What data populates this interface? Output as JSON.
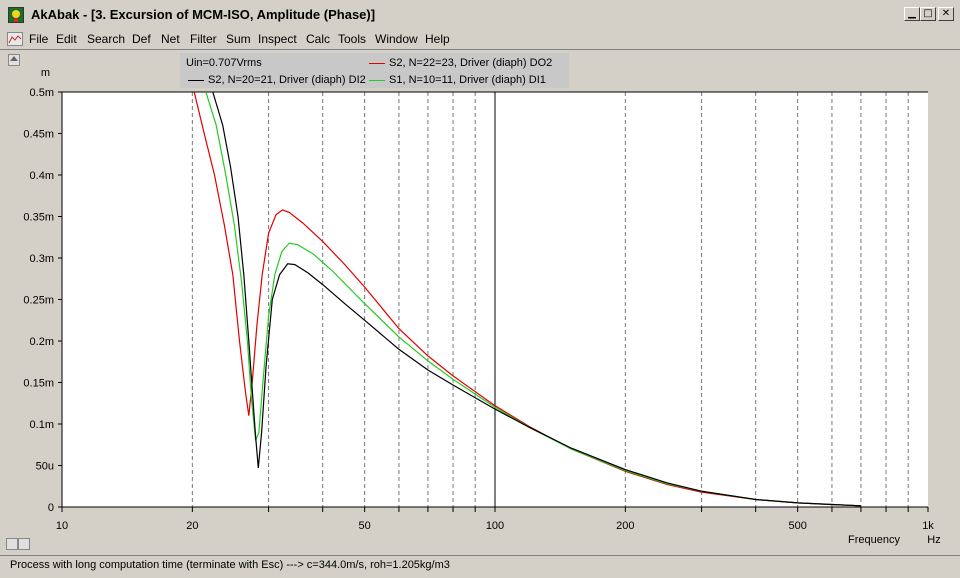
{
  "window": {
    "app_name": "AkAbak",
    "title": "AkAbak - [3. Excursion of MCM-ISO, Amplitude (Phase)]",
    "minimize": "▁",
    "maximize": "□",
    "close": "✕"
  },
  "menu": {
    "items": [
      "File",
      "Edit",
      "Search",
      "Def",
      "Net",
      "Filter",
      "Sum",
      "Inspect",
      "Calc",
      "Tools",
      "Window",
      "Help"
    ],
    "mdi_minimize": "▁",
    "mdi_restore": "❐",
    "mdi_close": "✕"
  },
  "legend": {
    "condition": "Uin=0.707Vrms",
    "entries": [
      {
        "label": "S2, N=20=21, Driver (diaph) DI2",
        "color": "#000000"
      },
      {
        "label": "S2, N=22=23, Driver (diaph) DO2",
        "color": "#e00000"
      },
      {
        "label": "S1, N=10=11, Driver (diaph) DI1",
        "color": "#22cc22"
      }
    ]
  },
  "chart_data": {
    "type": "line",
    "x_scale": "log",
    "xlim": [
      10,
      1000
    ],
    "ylim": [
      0,
      0.0005
    ],
    "ylabel": "m",
    "xlabel": "Frequency",
    "xunit": "Hz",
    "x_tick_labels": [
      {
        "v": 10,
        "t": "10"
      },
      {
        "v": 20,
        "t": "20"
      },
      {
        "v": 50,
        "t": "50"
      },
      {
        "v": 100,
        "t": "100"
      },
      {
        "v": 200,
        "t": "200"
      },
      {
        "v": 500,
        "t": "500"
      },
      {
        "v": 1000,
        "t": "1k"
      }
    ],
    "y_tick_labels": [
      {
        "v": 0.0005,
        "t": "0.5m"
      },
      {
        "v": 0.00045,
        "t": "0.45m"
      },
      {
        "v": 0.0004,
        "t": "0.4m"
      },
      {
        "v": 0.00035,
        "t": "0.35m"
      },
      {
        "v": 0.0003,
        "t": "0.3m"
      },
      {
        "v": 0.00025,
        "t": "0.25m"
      },
      {
        "v": 0.0002,
        "t": "0.2m"
      },
      {
        "v": 0.00015,
        "t": "0.15m"
      },
      {
        "v": 0.0001,
        "t": "0.1m"
      },
      {
        "v": 5e-05,
        "t": "50u"
      },
      {
        "v": 0,
        "t": "0"
      }
    ],
    "grid": true,
    "series": [
      {
        "name": "S2, N=20=21, Driver (diaph) DI2",
        "color": "#000000",
        "points": [
          [
            22.3,
            0.0005
          ],
          [
            23.5,
            0.00046
          ],
          [
            24.5,
            0.00041
          ],
          [
            25.5,
            0.00035
          ],
          [
            26.3,
            0.00028
          ],
          [
            27,
            0.0002
          ],
          [
            27.6,
            0.00013
          ],
          [
            28,
            8.5e-05
          ],
          [
            28.4,
            4.7e-05
          ],
          [
            28.9,
            9e-05
          ],
          [
            29.6,
            0.00017
          ],
          [
            30.6,
            0.00025
          ],
          [
            31.8,
            0.00028
          ],
          [
            33.2,
            0.000293
          ],
          [
            34.5,
            0.000292
          ],
          [
            37,
            0.000282
          ],
          [
            40,
            0.000268
          ],
          [
            45,
            0.000245
          ],
          [
            50,
            0.000225
          ],
          [
            60,
            0.00019
          ],
          [
            70,
            0.000165
          ],
          [
            80,
            0.000147
          ],
          [
            100,
            0.000118
          ],
          [
            120,
            9.6e-05
          ],
          [
            150,
            7.1e-05
          ],
          [
            200,
            4.5e-05
          ],
          [
            250,
            2.9e-05
          ],
          [
            300,
            1.9e-05
          ],
          [
            400,
            9e-06
          ],
          [
            500,
            5e-06
          ],
          [
            600,
            3e-06
          ],
          [
            700,
            1.5e-06
          ]
        ]
      },
      {
        "name": "S2, N=22=23, Driver (diaph) DO2",
        "color": "#e00000",
        "points": [
          [
            20.2,
            0.0005
          ],
          [
            21.3,
            0.00045
          ],
          [
            22.5,
            0.0004
          ],
          [
            23.7,
            0.00034
          ],
          [
            24.8,
            0.00028
          ],
          [
            25.7,
            0.0002
          ],
          [
            26.5,
            0.00014
          ],
          [
            27,
            0.00011
          ],
          [
            27.5,
            0.00015
          ],
          [
            28.2,
            0.00022
          ],
          [
            29,
            0.00028
          ],
          [
            30,
            0.00033
          ],
          [
            31.2,
            0.000352
          ],
          [
            32.3,
            0.000358
          ],
          [
            33.5,
            0.000355
          ],
          [
            36,
            0.000342
          ],
          [
            40,
            0.00032
          ],
          [
            45,
            0.000292
          ],
          [
            50,
            0.000265
          ],
          [
            60,
            0.000215
          ],
          [
            70,
            0.000182
          ],
          [
            80,
            0.000158
          ],
          [
            100,
            0.000122
          ],
          [
            120,
            9.7e-05
          ],
          [
            150,
            7e-05
          ],
          [
            200,
            4.3e-05
          ],
          [
            250,
            2.7e-05
          ],
          [
            300,
            1.8e-05
          ],
          [
            400,
            9e-06
          ],
          [
            500,
            5e-06
          ],
          [
            600,
            3e-06
          ],
          [
            700,
            1.5e-06
          ]
        ]
      },
      {
        "name": "S1, N=10=11, Driver (diaph) DI1",
        "color": "#22cc22",
        "points": [
          [
            21.5,
            0.0005
          ],
          [
            22.7,
            0.00046
          ],
          [
            23.9,
            0.0004
          ],
          [
            25,
            0.00034
          ],
          [
            26,
            0.00027
          ],
          [
            26.8,
            0.0002
          ],
          [
            27.4,
            0.00013
          ],
          [
            28,
            8e-05
          ],
          [
            28.5,
            9e-05
          ],
          [
            29.1,
            0.00015
          ],
          [
            30,
            0.00023
          ],
          [
            31,
            0.00028
          ],
          [
            32.2,
            0.000308
          ],
          [
            33.5,
            0.000318
          ],
          [
            35,
            0.000316
          ],
          [
            38,
            0.000305
          ],
          [
            42,
            0.000285
          ],
          [
            50,
            0.000245
          ],
          [
            60,
            0.000205
          ],
          [
            70,
            0.000176
          ],
          [
            80,
            0.000154
          ],
          [
            100,
            0.00012
          ],
          [
            120,
            9.6e-05
          ],
          [
            150,
            7e-05
          ],
          [
            200,
            4.4e-05
          ],
          [
            250,
            2.8e-05
          ],
          [
            300,
            1.9e-05
          ],
          [
            400,
            9e-06
          ],
          [
            500,
            5e-06
          ],
          [
            600,
            3e-06
          ],
          [
            700,
            1.5e-06
          ]
        ]
      }
    ]
  },
  "status": {
    "text": "Process with long computation time (terminate with Esc) ---> c=344.0m/s, roh=1.205kg/m3"
  }
}
